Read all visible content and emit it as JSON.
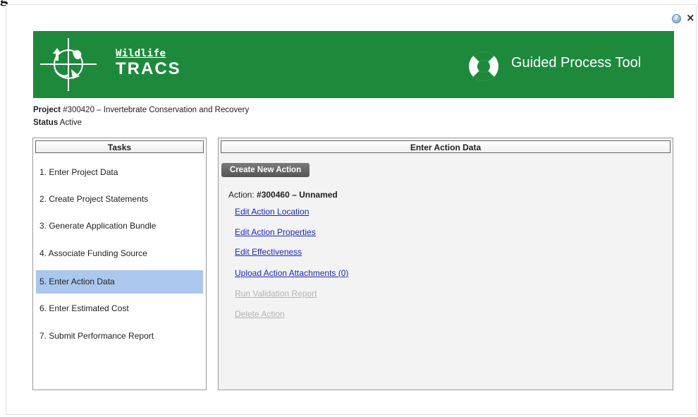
{
  "page_fragment": "g",
  "dialog": {
    "help_icon": "help-icon",
    "close_label": "×"
  },
  "banner": {
    "brand_top": "Wildlife",
    "brand_bottom": "TRACS",
    "tool_title": "Guided Process Tool",
    "color": "#1d8a3b"
  },
  "project": {
    "label": "Project",
    "value": "#300420 – Invertebrate Conservation and Recovery"
  },
  "status": {
    "label": "Status",
    "value": "Active"
  },
  "tasks": {
    "header": "Tasks",
    "items": [
      {
        "label": "1. Enter Project Data",
        "active": false
      },
      {
        "label": "2. Create Project Statements",
        "active": false
      },
      {
        "label": "3. Generate Application Bundle",
        "active": false
      },
      {
        "label": "4. Associate Funding Source",
        "active": false
      },
      {
        "label": "5. Enter Action Data",
        "active": true
      },
      {
        "label": "6. Enter Estimated Cost",
        "active": false
      },
      {
        "label": "7. Submit Performance Report",
        "active": false
      }
    ]
  },
  "main": {
    "header": "Enter Action Data",
    "create_button": "Create New Action",
    "action_label": "Action:",
    "action_value": "#300460 – Unnamed",
    "links": [
      {
        "label": "Edit Action Location",
        "enabled": true
      },
      {
        "label": "Edit Action Properties",
        "enabled": true
      },
      {
        "label": "Edit Effectiveness",
        "enabled": true
      },
      {
        "label": "Upload Action Attachments (0)",
        "enabled": true
      },
      {
        "label": "Run Validation Report",
        "enabled": false
      },
      {
        "label": "Delete Action",
        "enabled": false
      }
    ]
  }
}
